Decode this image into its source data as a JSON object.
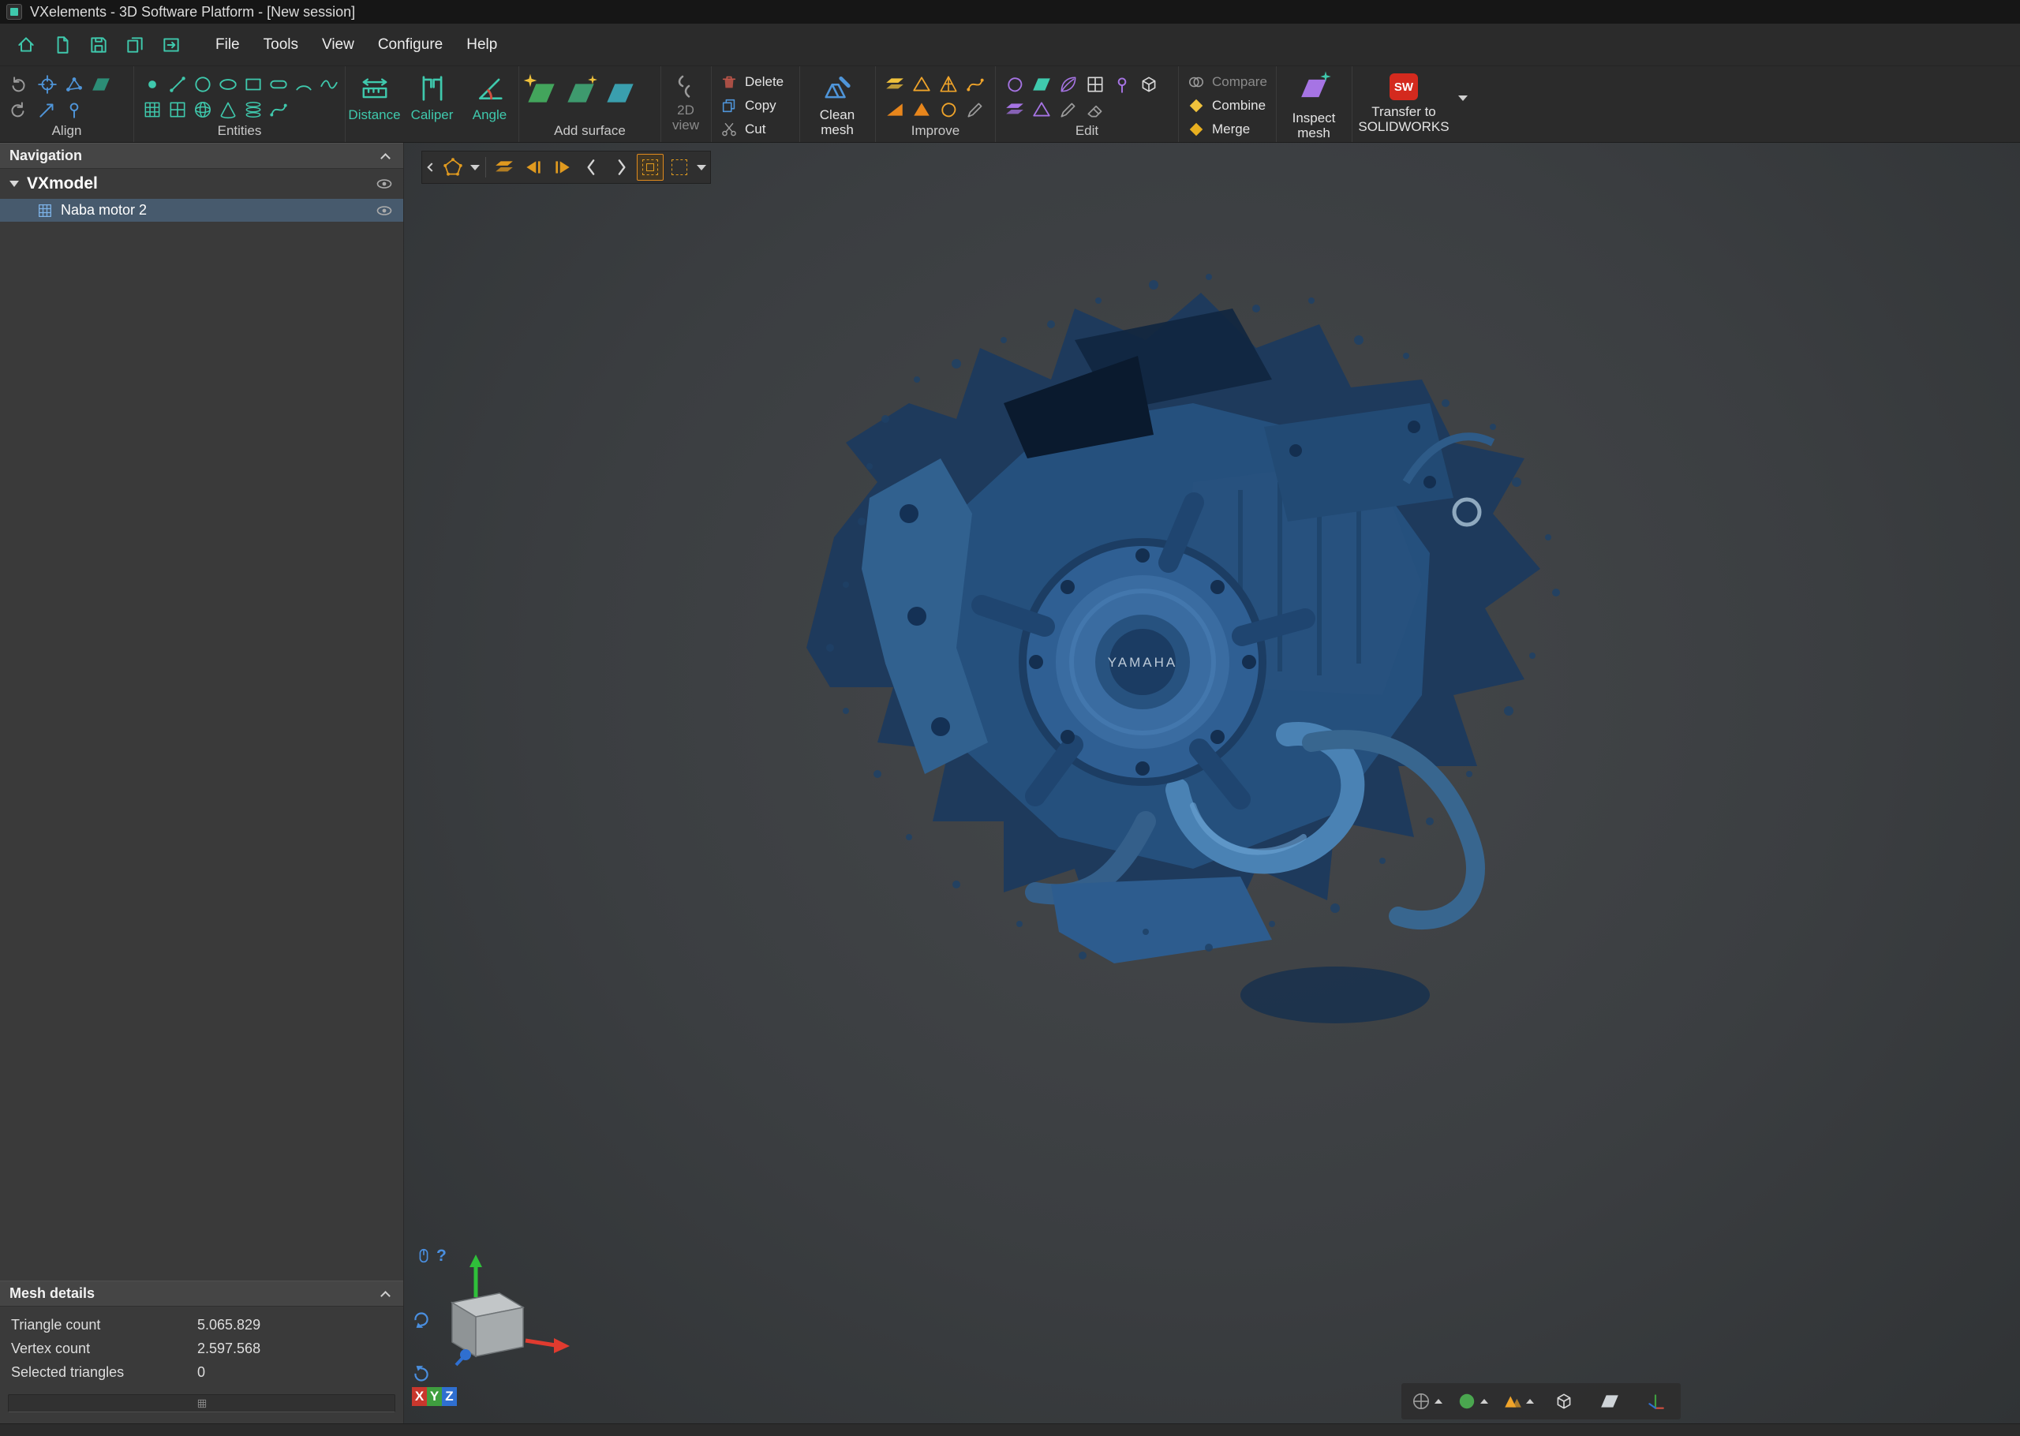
{
  "window": {
    "title": "VXelements - 3D Software Platform - [New session]"
  },
  "menubar": {
    "menus": [
      "File",
      "Tools",
      "View",
      "Configure",
      "Help"
    ]
  },
  "ribbon": {
    "groups": {
      "align": "Align",
      "entities": "Entities",
      "add_surface": "Add surface",
      "improve": "Improve",
      "edit": "Edit"
    },
    "buttons": {
      "distance": "Distance",
      "caliper": "Caliper",
      "angle": "Angle",
      "view2d_line1": "2D",
      "view2d_line2": "view",
      "delete": "Delete",
      "copy": "Copy",
      "cut": "Cut",
      "clean_mesh": "Clean mesh",
      "compare": "Compare",
      "combine": "Combine",
      "merge": "Merge",
      "inspect_mesh": "Inspect mesh",
      "transfer_line1": "Transfer to",
      "transfer_line2": "SOLIDWORKS",
      "sw_badge": "SW"
    }
  },
  "navigation": {
    "header": "Navigation",
    "root_label": "VXmodel",
    "items": [
      {
        "label": "Naba motor 2",
        "selected": true
      }
    ]
  },
  "mesh_details": {
    "header": "Mesh details",
    "rows": [
      {
        "label": "Triangle count",
        "value": "5.065.829"
      },
      {
        "label": "Vertex count",
        "value": "2.597.568"
      },
      {
        "label": "Selected triangles",
        "value": "0"
      }
    ]
  },
  "viewport": {
    "model_label": "YAMAHA",
    "help_label": "?",
    "axes": {
      "x": "X",
      "y": "Y",
      "z": "Z"
    }
  },
  "colors": {
    "accent_teal": "#3fc9ad",
    "accent_orange": "#f0a42a",
    "accent_purple": "#a674e4",
    "selection_row": "#475a6d",
    "mesh_blue": "#2d5c8e",
    "solidworks_red": "#d42a1e"
  }
}
